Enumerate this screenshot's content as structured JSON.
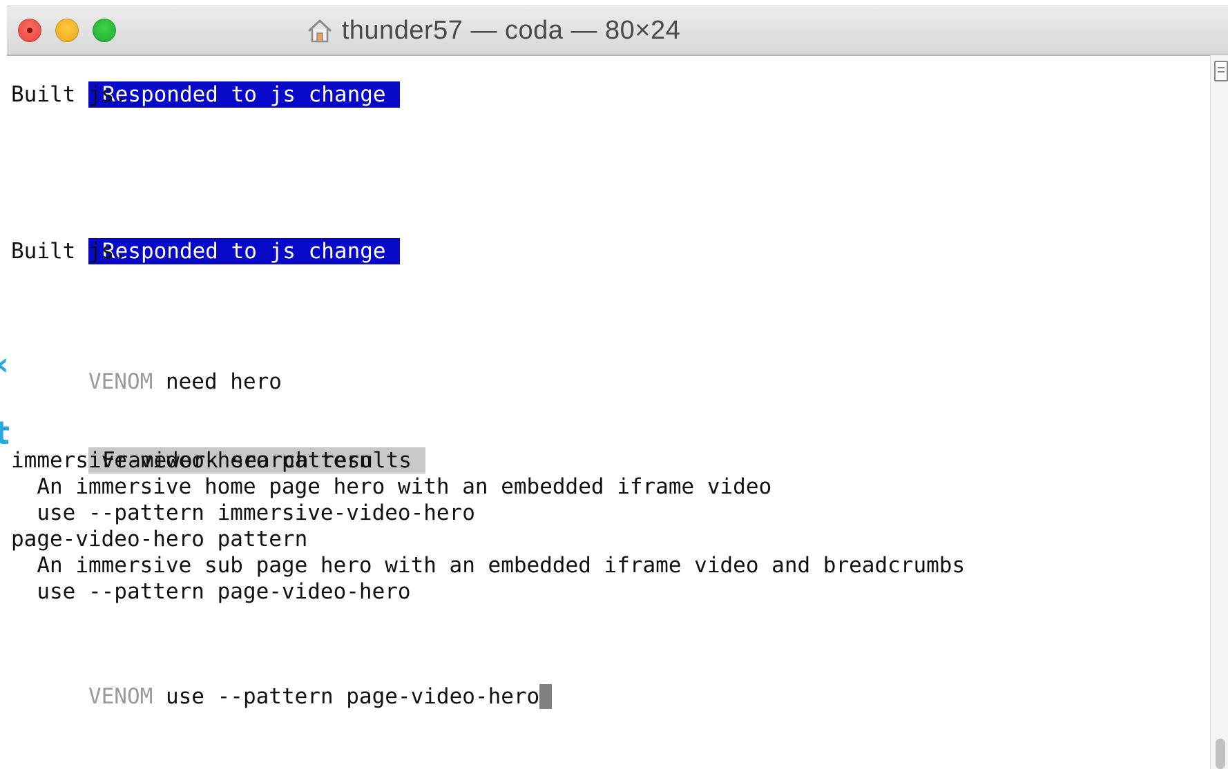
{
  "window": {
    "title": "thunder57 — coda — 80×24",
    "title_icon": "home-icon",
    "buttons": {
      "close": "close-button",
      "minimize": "minimize-button",
      "zoom": "zoom-button"
    }
  },
  "terminal": {
    "lines": {
      "l1": "Responded to js change",
      "l2": "Built js.",
      "l3": "Responded to js change",
      "l4": "Built js.",
      "l5_prompt": "VENOM",
      "l5_cmd": " need hero",
      "l6": "Framework search results",
      "l7": "immersive-video-hero pattern",
      "l8": "  An immersive home page hero with an embedded iframe video",
      "l9": "  use --pattern immersive-video-hero",
      "l10": "page-video-hero pattern",
      "l11": "  An immersive sub page hero with an embedded iframe video and breadcrumbs",
      "l12": "  use --pattern page-video-hero",
      "l13_prompt": "VENOM",
      "l13_cmd": " use --pattern page-video-hero"
    }
  },
  "colors": {
    "highlight_blue": "#0808c8",
    "highlight_gray": "#c8c8c8",
    "prompt_gray": "#9a9a9a",
    "edge_accent": "#29a7e0"
  }
}
